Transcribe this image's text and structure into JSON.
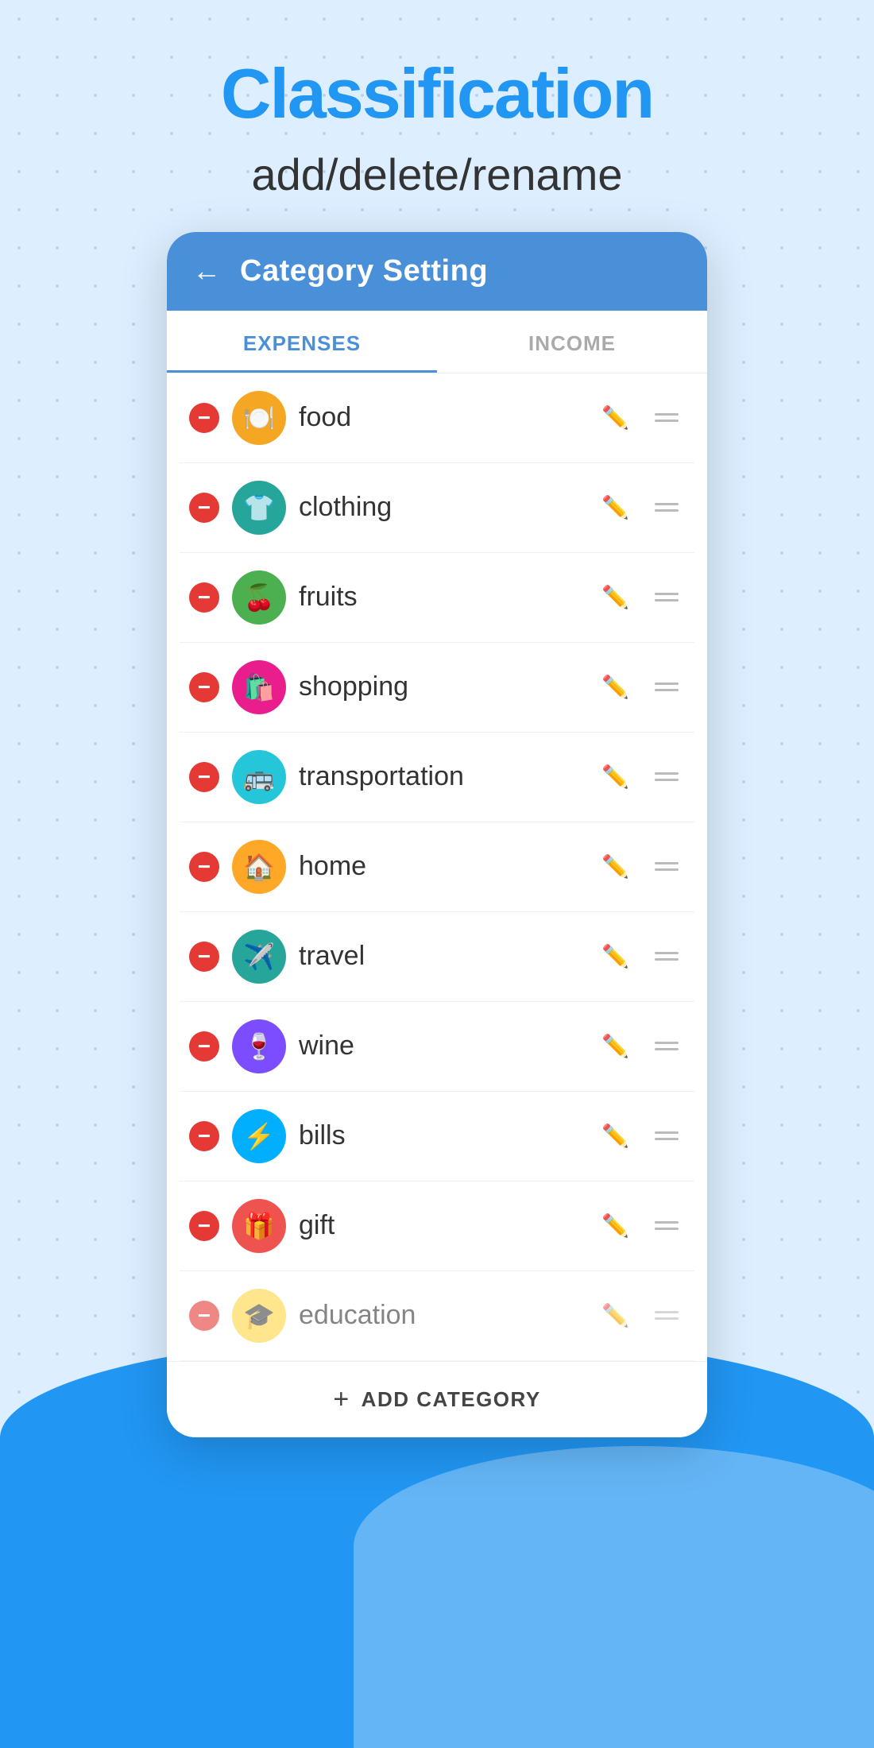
{
  "header": {
    "title": "Classification",
    "subtitle": "add/delete/rename"
  },
  "app_bar": {
    "title": "Category Setting",
    "back_label": "←"
  },
  "tabs": [
    {
      "id": "expenses",
      "label": "EXPENSES",
      "active": true
    },
    {
      "id": "income",
      "label": "INCOME",
      "active": false
    }
  ],
  "categories": [
    {
      "id": "food",
      "name": "food",
      "icon": "🍽️",
      "color_class": "icon-orange"
    },
    {
      "id": "clothing",
      "name": "clothing",
      "icon": "👕",
      "color_class": "icon-teal"
    },
    {
      "id": "fruits",
      "name": "fruits",
      "icon": "🍒",
      "color_class": "icon-green"
    },
    {
      "id": "shopping",
      "name": "shopping",
      "icon": "🛍️",
      "color_class": "icon-pink"
    },
    {
      "id": "transportation",
      "name": "transportation",
      "icon": "🚌",
      "color_class": "icon-teal2"
    },
    {
      "id": "home",
      "name": "home",
      "icon": "🏠",
      "color_class": "icon-gold"
    },
    {
      "id": "travel",
      "name": "travel",
      "icon": "✈️",
      "color_class": "icon-teal3"
    },
    {
      "id": "wine",
      "name": "wine",
      "icon": "🍷",
      "color_class": "icon-purple"
    },
    {
      "id": "bills",
      "name": "bills",
      "icon": "⚡",
      "color_class": "icon-cyan"
    },
    {
      "id": "gift",
      "name": "gift",
      "icon": "🎁",
      "color_class": "icon-salmon"
    },
    {
      "id": "education",
      "name": "education",
      "icon": "🎓",
      "color_class": "icon-yellow"
    }
  ],
  "add_button": {
    "label": "ADD CATEGORY",
    "plus": "+"
  },
  "colors": {
    "primary": "#4a90d9",
    "accent": "#2196f3",
    "delete": "#e53935"
  }
}
